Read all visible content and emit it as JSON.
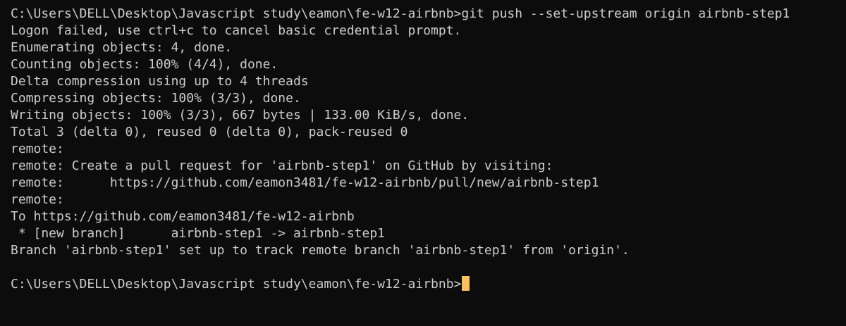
{
  "theme": {
    "background": "#0c0c0c",
    "foreground": "#cccccc",
    "cursor_color": "#f9c25c"
  },
  "terminal": {
    "lines": [
      "C:\\Users\\DELL\\Desktop\\Javascript study\\eamon\\fe-w12-airbnb>git push --set-upstream origin airbnb-step1",
      "Logon failed, use ctrl+c to cancel basic credential prompt.",
      "Enumerating objects: 4, done.",
      "Counting objects: 100% (4/4), done.",
      "Delta compression using up to 4 threads",
      "Compressing objects: 100% (3/3), done.",
      "Writing objects: 100% (3/3), 667 bytes | 133.00 KiB/s, done.",
      "Total 3 (delta 0), reused 0 (delta 0), pack-reused 0",
      "remote:",
      "remote: Create a pull request for 'airbnb-step1' on GitHub by visiting:",
      "remote:      https://github.com/eamon3481/fe-w12-airbnb/pull/new/airbnb-step1",
      "remote:",
      "To https://github.com/eamon3481/fe-w12-airbnb",
      " * [new branch]      airbnb-step1 -> airbnb-step1",
      "Branch 'airbnb-step1' set up to track remote branch 'airbnb-step1' from 'origin'.",
      ""
    ],
    "prompt": "C:\\Users\\DELL\\Desktop\\Javascript study\\eamon\\fe-w12-airbnb>"
  }
}
